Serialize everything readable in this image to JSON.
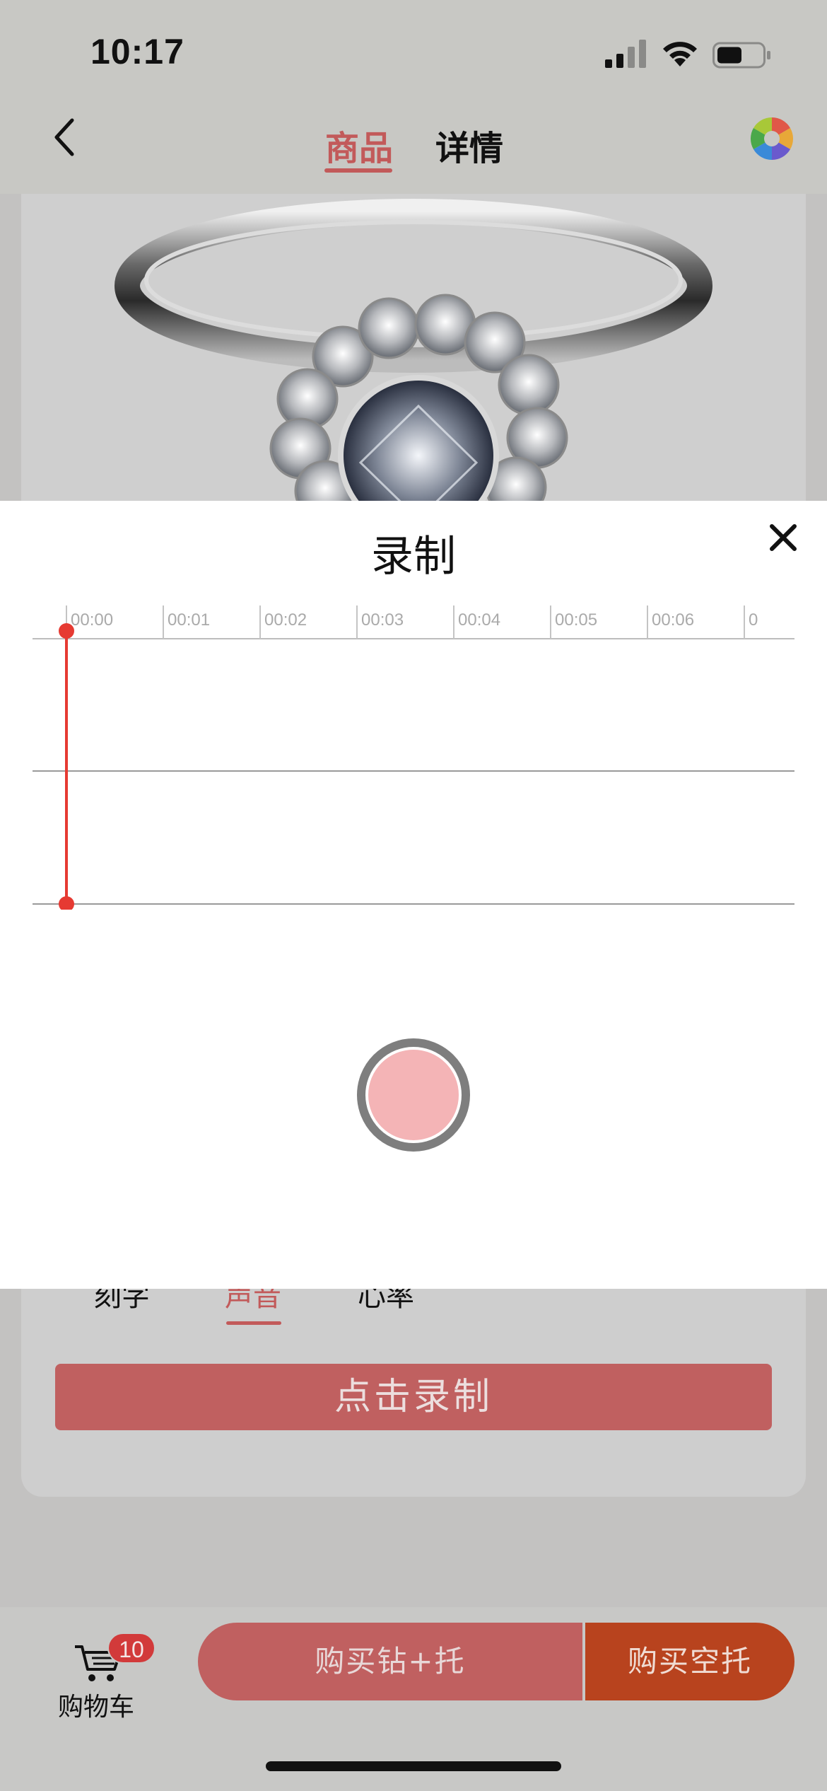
{
  "status_bar": {
    "time": "10:17",
    "signal_icon": "cellular-signal-icon",
    "wifi_icon": "wifi-icon",
    "battery_icon": "battery-icon",
    "battery_level": 0.55
  },
  "nav": {
    "back_icon": "chevron-left-icon",
    "tabs": [
      {
        "label": "商品",
        "active": true
      },
      {
        "label": "详情",
        "active": false
      }
    ],
    "right_icon": "aperture-icon"
  },
  "product": {
    "image": "diamond-ring-image"
  },
  "record_sheet": {
    "title": "录制",
    "close_icon": "close-icon",
    "timeline": {
      "ticks": [
        "00:00",
        "00:01",
        "00:02",
        "00:03",
        "00:04",
        "00:05",
        "00:06",
        "0"
      ],
      "playhead_position": "00:00",
      "playhead_color": "#e63a32"
    },
    "record_button_color": "#f4b4b6"
  },
  "customize": {
    "tabs": [
      {
        "label": "刻字",
        "active": false
      },
      {
        "label": "声音",
        "active": true
      },
      {
        "label": "心率",
        "active": false
      }
    ],
    "click_record_label": "点击录制"
  },
  "bottom_bar": {
    "cart_icon": "shopping-cart-icon",
    "cart_label": "购物车",
    "cart_badge": "10",
    "buy_set_label": "购买钻+托",
    "buy_empty_label": "购买空托"
  },
  "colors": {
    "accent": "#c25a5a",
    "buy_empty": "#b8431e",
    "badge": "#d23a3a"
  }
}
